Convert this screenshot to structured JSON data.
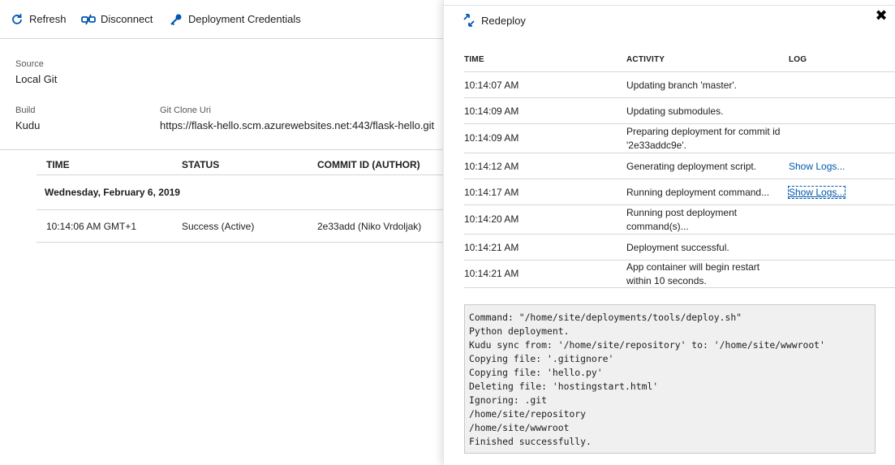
{
  "toolbar": {
    "refresh_label": "Refresh",
    "disconnect_label": "Disconnect",
    "credentials_label": "Deployment Credentials"
  },
  "source": {
    "label": "Source",
    "value": "Local Git"
  },
  "build": {
    "label": "Build",
    "value": "Kudu"
  },
  "git_clone_uri": {
    "label": "Git Clone Uri",
    "value": "https://flask-hello.scm.azurewebsites.net:443/flask-hello.git"
  },
  "deployments_table": {
    "columns": [
      "TIME",
      "STATUS",
      "COMMIT ID (AUTHOR)"
    ],
    "date_group": "Wednesday, February 6, 2019",
    "rows": [
      {
        "time": "10:14:06 AM GMT+1",
        "status": "Success (Active)",
        "commit": "2e33add (Niko Vrdoljak)"
      }
    ]
  },
  "panel": {
    "redeploy_label": "Redeploy",
    "close_glyph": "✖",
    "columns": [
      "TIME",
      "ACTIVITY",
      "LOG"
    ],
    "rows": [
      {
        "time": "10:14:07 AM",
        "activity": "Updating branch 'master'.",
        "log": ""
      },
      {
        "time": "10:14:09 AM",
        "activity": "Updating submodules.",
        "log": ""
      },
      {
        "time": "10:14:09 AM",
        "activity": "Preparing deployment for commit id '2e33addc9e'.",
        "log": ""
      },
      {
        "time": "10:14:12 AM",
        "activity": "Generating deployment script.",
        "log": "Show Logs..."
      },
      {
        "time": "10:14:17 AM",
        "activity": "Running deployment command...",
        "log": "Show Logs..."
      },
      {
        "time": "10:14:20 AM",
        "activity": "Running post deployment command(s)...",
        "log": ""
      },
      {
        "time": "10:14:21 AM",
        "activity": "Deployment successful.",
        "log": ""
      },
      {
        "time": "10:14:21 AM",
        "activity": "App container will begin restart within 10 seconds.",
        "log": ""
      }
    ],
    "console_lines": [
      "Command: \"/home/site/deployments/tools/deploy.sh\"",
      "Python deployment.",
      "Kudu sync from: '/home/site/repository' to: '/home/site/wwwroot'",
      "Copying file: '.gitignore'",
      "Copying file: 'hello.py'",
      "Deleting file: 'hostingstart.html'",
      "Ignoring: .git",
      "/home/site/repository",
      "/home/site/wwwroot",
      "Finished successfully."
    ]
  },
  "colors": {
    "accent": "#0058ad",
    "separator": "#d6d6d6",
    "console_bg": "#f0f0f0"
  }
}
